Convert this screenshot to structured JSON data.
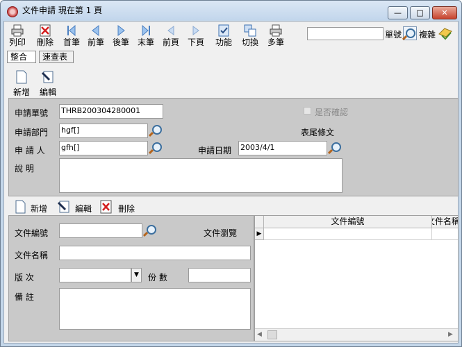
{
  "window": {
    "title": "文件申請  現在第 1 頁",
    "minimize_glyph": "—",
    "maximize_glyph": "□",
    "close_glyph": "✕"
  },
  "toolbar": {
    "print": "列印",
    "delete": "刪除",
    "first": "首筆",
    "prev": "前筆",
    "next": "後筆",
    "last": "末筆",
    "prev_page": "前頁",
    "next_page": "下頁",
    "function": "功能",
    "switch": "切換",
    "multi": "多筆",
    "search_value": "",
    "search_label": "單號",
    "complex": "複雜"
  },
  "tabs": {
    "integrated": "整合",
    "quick_table": "速查表"
  },
  "actions": {
    "add": "新增",
    "edit": "編輯"
  },
  "form": {
    "apply_no_label": "申請單號",
    "apply_no": "THRB200304280001",
    "dept_label": "申請部門",
    "dept": "hgf[]",
    "applicant_label": "申  請  人",
    "applicant": "gfh[]",
    "date_label": "申請日期",
    "date": "2003/4/1",
    "desc_label": "說      明",
    "desc": "",
    "confirm_label": "是否確認",
    "footer_label": "表尾條文"
  },
  "detail_actions": {
    "add": "新增",
    "edit": "編輯",
    "delete": "刪除"
  },
  "detail": {
    "doc_no_label": "文件編號",
    "doc_no": "",
    "browse_label": "文件瀏覽",
    "doc_name_label": "文件名稱",
    "doc_name": "",
    "version_label": "版      次",
    "version": "",
    "copies_label": "份    數",
    "copies": "",
    "remark_label": "備      註",
    "remark": ""
  },
  "grid": {
    "col1": "文件編號",
    "col2": "文件名稱"
  }
}
